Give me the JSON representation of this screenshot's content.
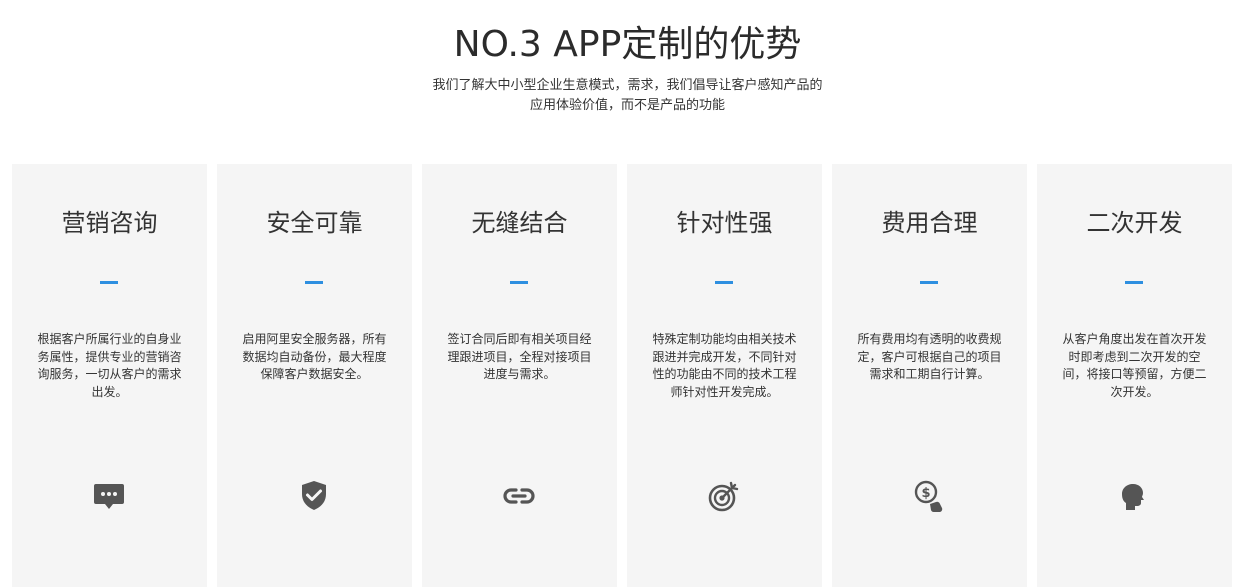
{
  "header": {
    "title": "NO.3 APP定制的优势",
    "subtitle_line1": "我们了解大中小型企业生意模式，需求，我们倡导让客户感知产品的",
    "subtitle_line2": "应用体验价值，而不是产品的功能"
  },
  "cards": [
    {
      "title": "营销咨询",
      "desc": "根据客户所属行业的自身业务属性，提供专业的营销咨询服务，一切从客户的需求出发。",
      "icon": "chat-bubble-icon"
    },
    {
      "title": "安全可靠",
      "desc": "启用阿里安全服务器，所有数据均自动备份，最大程度保障客户数据安全。",
      "icon": "shield-check-icon"
    },
    {
      "title": "无缝结合",
      "desc": "签订合同后即有相关项目经理跟进项目，全程对接项目进度与需求。",
      "icon": "link-icon"
    },
    {
      "title": "针对性强",
      "desc": "特殊定制功能均由相关技术跟进并完成开发，不同针对性的功能由不同的技术工程师针对性开发完成。",
      "icon": "target-icon"
    },
    {
      "title": "费用合理",
      "desc": "所有费用均有透明的收费规定，客户可根据自己的项目需求和工期自行计算。",
      "icon": "dollar-hand-icon"
    },
    {
      "title": "二次开发",
      "desc": "从客户角度出发在首次开发时即考虑到二次开发的空间，将接口等预留，方便二次开发。",
      "icon": "head-profile-icon"
    }
  ],
  "colors": {
    "accent": "#2e8fe0",
    "card_bg": "#f5f5f5",
    "icon": "#555555"
  }
}
